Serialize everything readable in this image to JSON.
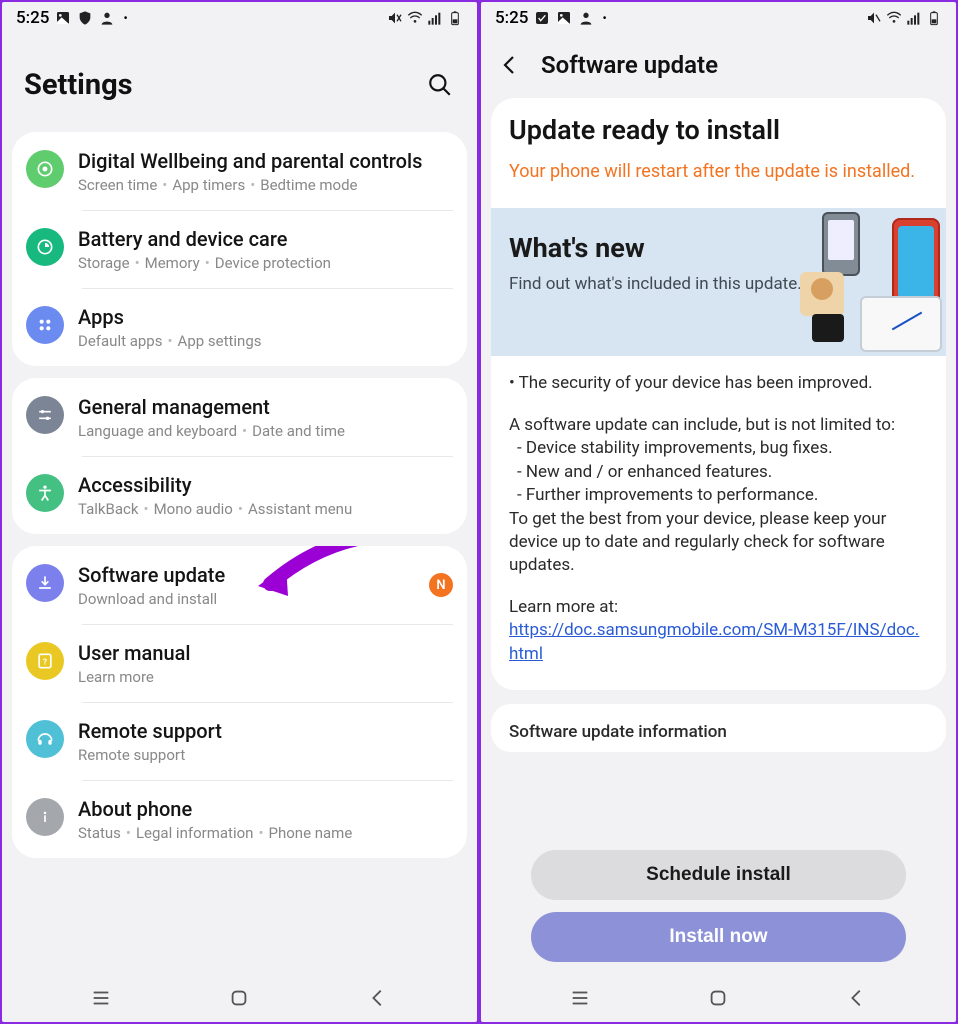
{
  "statusbar": {
    "time": "5:25",
    "icons_left": [
      "image-icon",
      "shield-icon",
      "person-icon"
    ],
    "icons_right": [
      "mute-icon",
      "wifi-icon",
      "signal-icon",
      "battery-icon"
    ]
  },
  "screen1": {
    "title": "Settings",
    "groups": [
      [
        {
          "id": "wellbeing",
          "title": "Digital Wellbeing and parental controls",
          "sub": [
            "Screen time",
            "App timers",
            "Bedtime mode"
          ],
          "icon": "ic-wellbeing"
        },
        {
          "id": "battery",
          "title": "Battery and device care",
          "sub": [
            "Storage",
            "Memory",
            "Device protection"
          ],
          "icon": "ic-battery"
        },
        {
          "id": "apps",
          "title": "Apps",
          "sub": [
            "Default apps",
            "App settings"
          ],
          "icon": "ic-apps"
        }
      ],
      [
        {
          "id": "general",
          "title": "General management",
          "sub": [
            "Language and keyboard",
            "Date and time"
          ],
          "icon": "ic-general"
        },
        {
          "id": "accessibility",
          "title": "Accessibility",
          "sub": [
            "TalkBack",
            "Mono audio",
            "Assistant menu"
          ],
          "icon": "ic-accessibility"
        }
      ],
      [
        {
          "id": "software",
          "title": "Software update",
          "sub": [
            "Download and install"
          ],
          "icon": "ic-software",
          "badge": "N",
          "highlighted": true
        },
        {
          "id": "manual",
          "title": "User manual",
          "sub": [
            "Learn more"
          ],
          "icon": "ic-manual"
        },
        {
          "id": "remote",
          "title": "Remote support",
          "sub": [
            "Remote support"
          ],
          "icon": "ic-remote"
        },
        {
          "id": "about",
          "title": "About phone",
          "sub": [
            "Status",
            "Legal information",
            "Phone name"
          ],
          "icon": "ic-about"
        }
      ]
    ]
  },
  "statusbar2": {
    "time": "5:25",
    "icons_left": [
      "check-icon",
      "image-icon",
      "person-icon"
    ]
  },
  "screen2": {
    "header": "Software update",
    "title": "Update ready to install",
    "warn": "Your phone will restart after the update is installed.",
    "whatsnew_title": "What's new",
    "whatsnew_sub": "Find out what's included in this update.",
    "bullet1": "• The security of your device has been improved.",
    "para1": "A software update can include, but is not limited to:",
    "sub1": " - Device stability improvements, bug fixes.",
    "sub2": " - New and / or enhanced features.",
    "sub3": " - Further improvements to performance.",
    "para2": "To get the best from your device, please keep your device up to date and regularly check for software updates.",
    "learn_label": "Learn more at:",
    "learn_url": "https://doc.samsungmobile.com/SM-M315F/INS/doc.html",
    "info_title": "Software update information",
    "btn_schedule": "Schedule install",
    "btn_install": "Install now"
  },
  "colors": {
    "accent_orange": "#f37321",
    "accent_link": "#2a5bd7",
    "install_btn": "#8d92d8"
  }
}
